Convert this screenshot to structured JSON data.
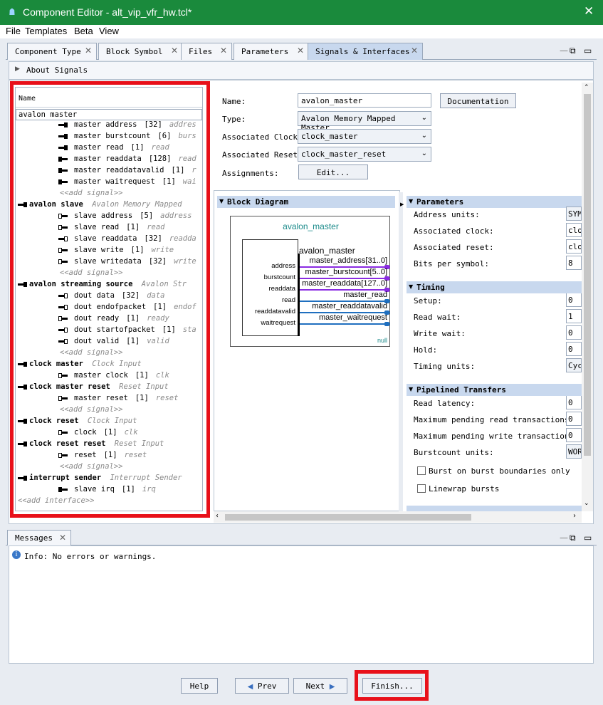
{
  "window": {
    "title": "Component Editor - alt_vip_vfr_hw.tcl*",
    "close": "✕"
  },
  "menu": [
    "File",
    "Templates",
    "Beta",
    "View"
  ],
  "tabs": [
    {
      "label": "Component Type"
    },
    {
      "label": "Block Symbol"
    },
    {
      "label": "Files"
    },
    {
      "label": "Parameters"
    },
    {
      "label": "Signals & Interfaces",
      "active": true
    }
  ],
  "about": {
    "label": "About Signals"
  },
  "tree": {
    "header": "Name",
    "rows": [
      {
        "text": "avalon master",
        "level": 0,
        "bold": false,
        "type": "iface-selected"
      },
      {
        "text": "master address",
        "width": "[32]",
        "role": "addres",
        "dir": "out",
        "level": 2
      },
      {
        "text": "master burstcount",
        "width": "[6]",
        "role": "burs",
        "dir": "out",
        "level": 2
      },
      {
        "text": "master read",
        "width": "[1]",
        "role": "read",
        "dir": "out",
        "level": 2
      },
      {
        "text": "master readdata",
        "width": "[128]",
        "role": "read",
        "dir": "in",
        "level": 2
      },
      {
        "text": "master readdatavalid",
        "width": "[1]",
        "role": "r",
        "dir": "in",
        "level": 2
      },
      {
        "text": "master waitrequest",
        "width": "[1]",
        "role": "wai",
        "dir": "in",
        "level": 2
      },
      {
        "text": "<<add signal>>",
        "level": 2,
        "type": "add"
      },
      {
        "text": "avalon slave",
        "kind": "Avalon Memory Mapped",
        "level": 0,
        "type": "iface"
      },
      {
        "text": "slave address",
        "width": "[5]",
        "role": "address",
        "dir": "inw",
        "level": 2
      },
      {
        "text": "slave read",
        "width": "[1]",
        "role": "read",
        "dir": "inw",
        "level": 2
      },
      {
        "text": "slave readdata",
        "width": "[32]",
        "role": "readda",
        "dir": "outw",
        "level": 2
      },
      {
        "text": "slave write",
        "width": "[1]",
        "role": "write",
        "dir": "inw",
        "level": 2
      },
      {
        "text": "slave writedata",
        "width": "[32]",
        "role": "write",
        "dir": "inw",
        "level": 2
      },
      {
        "text": "<<add signal>>",
        "level": 2,
        "type": "add"
      },
      {
        "text": "avalon streaming source",
        "kind": "Avalon Str",
        "level": 0,
        "type": "iface"
      },
      {
        "text": "dout data",
        "width": "[32]",
        "role": "data",
        "dir": "outw",
        "level": 2
      },
      {
        "text": "dout endofpacket",
        "width": "[1]",
        "role": "endof",
        "dir": "outw",
        "level": 2
      },
      {
        "text": "dout ready",
        "width": "[1]",
        "role": "ready",
        "dir": "inw",
        "level": 2
      },
      {
        "text": "dout startofpacket",
        "width": "[1]",
        "role": "sta",
        "dir": "outw",
        "level": 2
      },
      {
        "text": "dout valid",
        "width": "[1]",
        "role": "valid",
        "dir": "outw",
        "level": 2
      },
      {
        "text": "<<add signal>>",
        "level": 2,
        "type": "add"
      },
      {
        "text": "clock master",
        "kind": "Clock Input",
        "level": 0,
        "type": "iface"
      },
      {
        "text": "master clock",
        "width": "[1]",
        "role": "clk",
        "dir": "inw",
        "level": 2
      },
      {
        "text": "clock master reset",
        "kind": "Reset Input",
        "level": 0,
        "type": "iface"
      },
      {
        "text": "master reset",
        "width": "[1]",
        "role": "reset",
        "dir": "inw",
        "level": 2
      },
      {
        "text": "<<add signal>>",
        "level": 2,
        "type": "add"
      },
      {
        "text": "clock reset",
        "kind": "Clock Input",
        "level": 0,
        "type": "iface"
      },
      {
        "text": "clock",
        "width": "[1]",
        "role": "clk",
        "dir": "inw",
        "level": 2
      },
      {
        "text": "clock reset reset",
        "kind": "Reset Input",
        "level": 0,
        "type": "iface"
      },
      {
        "text": "reset",
        "width": "[1]",
        "role": "reset",
        "dir": "inw",
        "level": 2
      },
      {
        "text": "<<add signal>>",
        "level": 2,
        "type": "add"
      },
      {
        "text": "interrupt sender",
        "kind": "Interrupt Sender",
        "level": 0,
        "type": "iface"
      },
      {
        "text": "slave irq",
        "width": "[1]",
        "role": "irq",
        "dir": "in",
        "level": 2
      },
      {
        "text": "<<add interface>>",
        "level": 0,
        "type": "addiface"
      }
    ]
  },
  "form": {
    "name_label": "Name:",
    "name_value": "avalon_master",
    "doc_button": "Documentation",
    "type_label": "Type:",
    "type_value": "Avalon Memory Mapped Master",
    "clock_label": "Associated Clock:",
    "clock_value": "clock_master",
    "reset_label": "Associated Reset:",
    "reset_value": "clock_master_reset",
    "assign_label": "Assignments:",
    "edit_button": "Edit..."
  },
  "block": {
    "header": "Block Diagram",
    "title": "avalon_master",
    "inner_title": "avalon_master",
    "left_pins": [
      "address",
      "burstcount",
      "readdata",
      "read",
      "readdatavalid",
      "waitrequest"
    ],
    "right_pins": [
      "master_address[31..0]",
      "master_burstcount[5..0]",
      "master_readdata[127..0]",
      "master_read",
      "master_readdatavalid",
      "master_waitrequest"
    ],
    "footer": "null",
    "colors": {
      "title": "#1a8a8a",
      "purple": "#8a2be2",
      "blue": "#1f6fbf"
    }
  },
  "params": {
    "header": "Parameters",
    "rows": [
      {
        "label": "Address units:",
        "value": "SYM"
      },
      {
        "label": "Associated clock:",
        "value": "clo"
      },
      {
        "label": "Associated reset:",
        "value": "clo"
      },
      {
        "label": "Bits per symbol:",
        "value": "8"
      }
    ],
    "timing_header": "Timing",
    "timing": [
      {
        "label": "Setup:",
        "value": "0"
      },
      {
        "label": "Read wait:",
        "value": "1"
      },
      {
        "label": "Write wait:",
        "value": "0"
      },
      {
        "label": "Hold:",
        "value": "0"
      },
      {
        "label": "Timing units:",
        "value": "Cyc"
      }
    ],
    "pipe_header": "Pipelined Transfers",
    "pipe": [
      {
        "label": "Read latency:",
        "value": "0"
      },
      {
        "label": "Maximum pending read transactions:",
        "value": "0"
      },
      {
        "label": "Maximum pending write transactions:",
        "value": "0"
      },
      {
        "label": "Burstcount units:",
        "value": "WOR"
      }
    ],
    "checks": [
      "Burst on burst boundaries only",
      "Linewrap bursts"
    ]
  },
  "messages": {
    "tab": "Messages",
    "info": "Info: No errors or warnings."
  },
  "buttons": {
    "help": "Help",
    "prev": "Prev",
    "next": "Next",
    "finish": "Finish..."
  }
}
